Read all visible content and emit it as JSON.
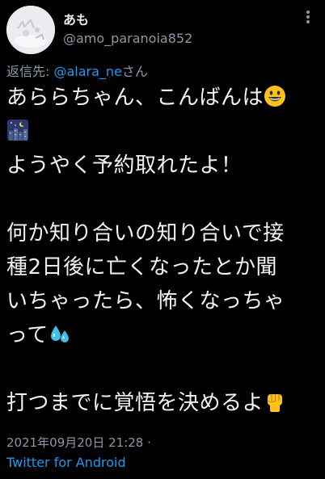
{
  "author": {
    "display_name": "あも",
    "handle": "@amo_paranoia852"
  },
  "reply": {
    "prefix": "返信先: ",
    "mention": "@alara_ne",
    "suffix": "さん"
  },
  "tweet": {
    "line1": "あららちゃん、こんばんは",
    "line3": "ようやく予約取れたよ！",
    "line5": "何か知り合いの知り合いで接",
    "line6": "種2日後に亡くなったとか聞",
    "line7": "いちゃったら、怖くなっちゃ",
    "line8": "って",
    "line10": "打つまでに覚悟を決めるよ"
  },
  "meta": {
    "timestamp": "2021年09月20日 21:28 ·",
    "source": "Twitter for Android"
  },
  "icons": {
    "more": "more-vertical-icon",
    "emoji_grin": "grinning-face-icon",
    "emoji_night": "night-city-icon",
    "emoji_sweat": "sweat-droplets-icon",
    "emoji_fist": "raised-fist-icon"
  },
  "colors": {
    "background": "#000000",
    "text": "#e7e9ea",
    "secondary": "#8b98a5",
    "link": "#1d9bf0"
  }
}
